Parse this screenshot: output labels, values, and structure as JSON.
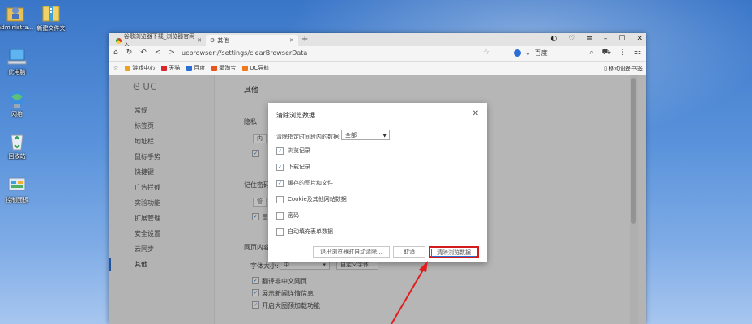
{
  "desktop": {
    "icons": [
      {
        "label": "Administra...",
        "icon": "user-folder-icon"
      },
      {
        "label": "新建文件夹",
        "icon": "folder-zip-icon"
      },
      {
        "label": "此电脑",
        "icon": "computer-icon"
      },
      {
        "label": "网络",
        "icon": "network-icon"
      },
      {
        "label": "回收站",
        "icon": "recycle-bin-icon"
      },
      {
        "label": "控制面板",
        "icon": "control-panel-icon"
      }
    ]
  },
  "browser": {
    "tabs": [
      {
        "label": "谷歌浏览器下载_浏览器官网入",
        "close": "✕"
      },
      {
        "label": "其他",
        "close": "✕"
      }
    ],
    "new_tab": "+",
    "url": "ucbrowser://settings/clearBrowserData",
    "search_engine": "百度",
    "bookmarks": [
      {
        "label": "游戏中心",
        "color": "#f0a020"
      },
      {
        "label": "天猫",
        "color": "#d9262c"
      },
      {
        "label": "百度",
        "color": "#2b6fd6"
      },
      {
        "label": "聚淘宝",
        "color": "#e8541e"
      },
      {
        "label": "UC导航",
        "color": "#f07a1a"
      }
    ],
    "bookmark_right": "移动设备书签"
  },
  "settings": {
    "brand": "UC",
    "nav": [
      "常规",
      "标签页",
      "地址栏",
      "鼠标手势",
      "快捷键",
      "广告拦截",
      "实验功能",
      "扩展管理",
      "安全设置",
      "云同步",
      "其他"
    ],
    "active_nav": "其他",
    "title": "其他",
    "privacy_label": "隐私",
    "privacy_btn": "内",
    "remember_label": "记住密码",
    "remember_btn": "管",
    "remember_check": "显",
    "page_content_label": "网页内容",
    "font_size_label": "字体大小:",
    "font_size_value": "中",
    "custom_font_btn": "自定义字体...",
    "checks": [
      "翻译非中文网页",
      "展示新闻详情信息",
      "开启大图预加载功能"
    ]
  },
  "dialog": {
    "title": "清除浏览数据",
    "close": "✕",
    "range_label": "清除指定时间段内的数据:",
    "range_value": "全部",
    "options": [
      {
        "label": "浏览记录",
        "checked": true
      },
      {
        "label": "下载记录",
        "checked": true
      },
      {
        "label": "缓存的图片和文件",
        "checked": true
      },
      {
        "label": "Cookie及其他网站数据",
        "checked": false
      },
      {
        "label": "密码",
        "checked": false
      },
      {
        "label": "自动填充表单数据",
        "checked": false
      }
    ],
    "btn_auto_clear": "退出浏览器时自动清除...",
    "btn_cancel": "取消",
    "btn_clear": "清除浏览数据"
  },
  "colors": {
    "accent": "#2b6fd6",
    "highlight": "#d31b1b"
  }
}
